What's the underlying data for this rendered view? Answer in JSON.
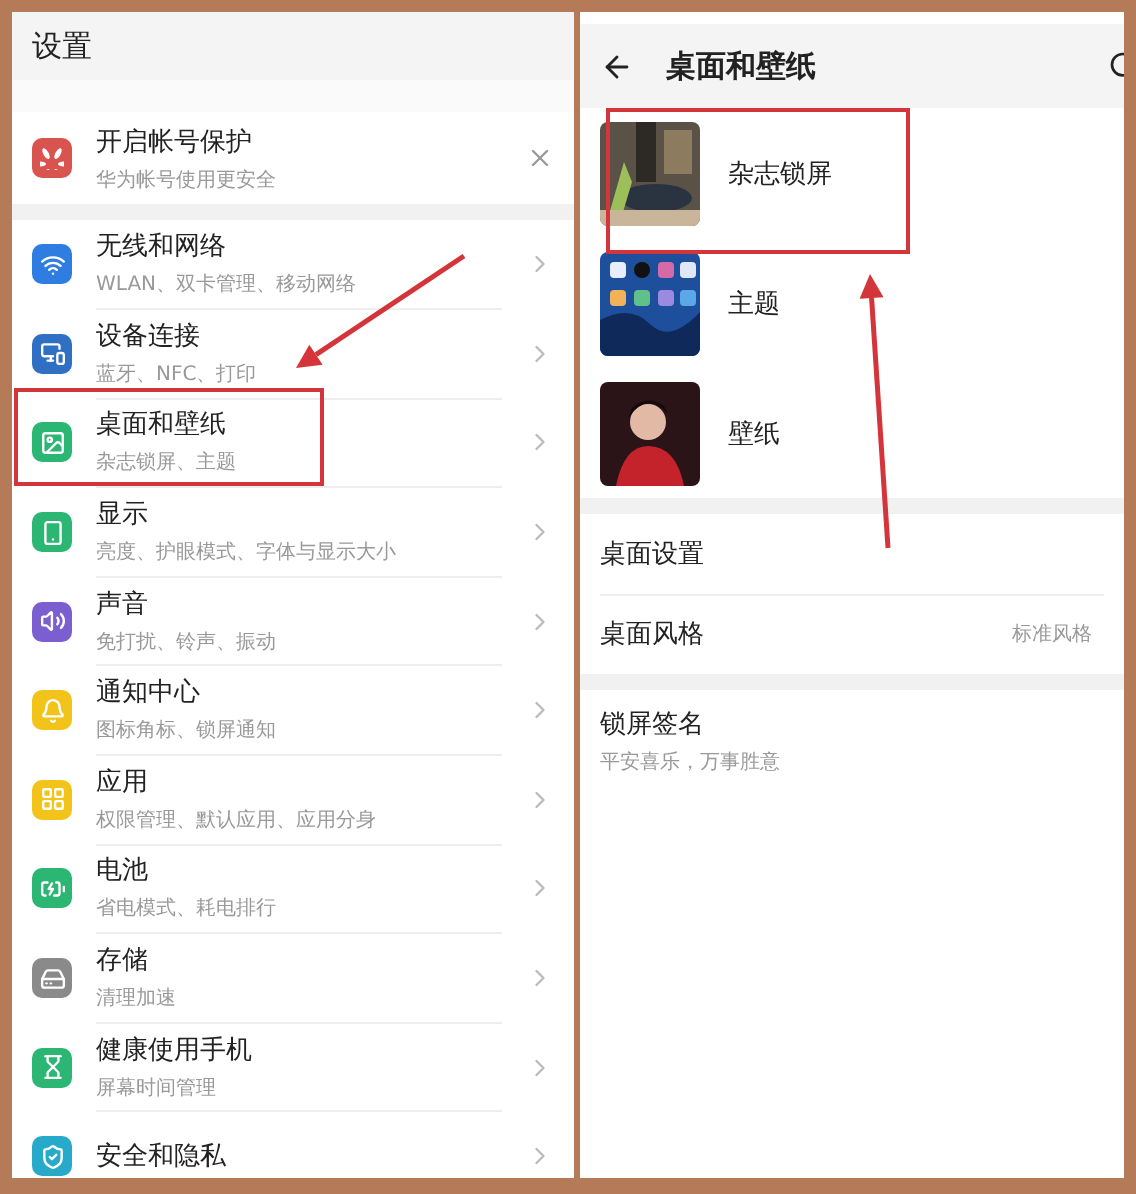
{
  "settings": {
    "title": "设置",
    "account_card": {
      "title": "开启帐号保护",
      "subtitle": "华为帐号使用更安全"
    },
    "items": [
      {
        "title": "无线和网络",
        "subtitle": "WLAN、双卡管理、移动网络",
        "highlighted": false
      },
      {
        "title": "设备连接",
        "subtitle": "蓝牙、NFC、打印",
        "highlighted": false
      },
      {
        "title": "桌面和壁纸",
        "subtitle": "杂志锁屏、主题",
        "highlighted": true
      },
      {
        "title": "显示",
        "subtitle": "亮度、护眼模式、字体与显示大小",
        "highlighted": false
      },
      {
        "title": "声音",
        "subtitle": "免打扰、铃声、振动",
        "highlighted": false
      },
      {
        "title": "通知中心",
        "subtitle": "图标角标、锁屏通知",
        "highlighted": false
      },
      {
        "title": "应用",
        "subtitle": "权限管理、默认应用、应用分身",
        "highlighted": false
      },
      {
        "title": "电池",
        "subtitle": "省电模式、耗电排行",
        "highlighted": false
      },
      {
        "title": "存储",
        "subtitle": "清理加速",
        "highlighted": false
      },
      {
        "title": "健康使用手机",
        "subtitle": "屏幕时间管理",
        "highlighted": false
      },
      {
        "title": "安全和隐私",
        "highlighted": false
      }
    ]
  },
  "wallpaper": {
    "title": "桌面和壁纸",
    "thumbnails": [
      {
        "label": "杂志锁屏",
        "highlighted": true
      },
      {
        "label": "主题",
        "highlighted": false
      },
      {
        "label": "壁纸",
        "highlighted": false
      }
    ],
    "settings": [
      {
        "title": "桌面设置"
      },
      {
        "title": "桌面风格",
        "value": "标准风格"
      }
    ],
    "signature": {
      "title": "锁屏签名",
      "subtitle": "平安喜乐，万事胜意"
    }
  }
}
